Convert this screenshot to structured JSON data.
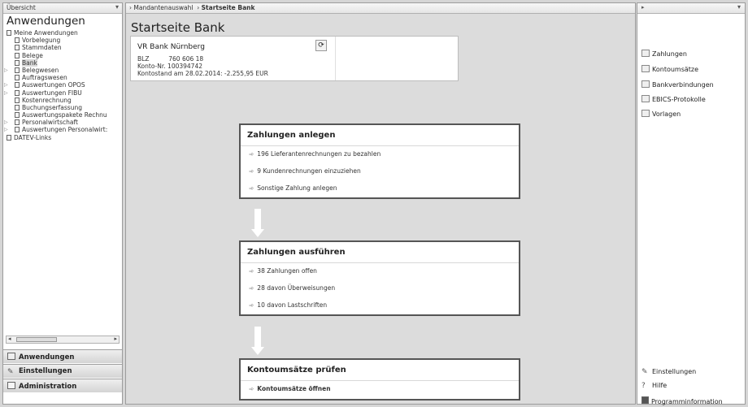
{
  "left_panel": {
    "header_label": "Übersicht",
    "title": "Anwendungen",
    "tree": [
      {
        "label": "Meine Anwendungen",
        "level": 0,
        "expander": "",
        "selected": false
      },
      {
        "label": "Vorbelegung",
        "level": 1,
        "expander": "",
        "selected": false
      },
      {
        "label": "Stammdaten",
        "level": 1,
        "expander": "",
        "selected": false
      },
      {
        "label": "Belege",
        "level": 1,
        "expander": "",
        "selected": false
      },
      {
        "label": "Bank",
        "level": 1,
        "expander": "",
        "selected": true
      },
      {
        "label": "Belegwesen",
        "level": 1,
        "expander": "▷",
        "selected": false
      },
      {
        "label": "Auftragswesen",
        "level": 1,
        "expander": "",
        "selected": false
      },
      {
        "label": "Auswertungen OPOS",
        "level": 1,
        "expander": "▷",
        "selected": false
      },
      {
        "label": "Auswertungen FIBU",
        "level": 1,
        "expander": "▷",
        "selected": false
      },
      {
        "label": "Kostenrechnung",
        "level": 1,
        "expander": "",
        "selected": false
      },
      {
        "label": "Buchungserfassung",
        "level": 1,
        "expander": "",
        "selected": false
      },
      {
        "label": "Auswertungspakete Rechnu",
        "level": 1,
        "expander": "",
        "selected": false
      },
      {
        "label": "Personalwirtschaft",
        "level": 1,
        "expander": "▷",
        "selected": false
      },
      {
        "label": "Auswertungen Personalwirt:",
        "level": 1,
        "expander": "▷",
        "selected": false
      },
      {
        "label": "DATEV-Links",
        "level": 0,
        "expander": "",
        "selected": false
      }
    ],
    "accordion": [
      {
        "label": "Anwendungen"
      },
      {
        "label": "Einstellungen"
      },
      {
        "label": "Administration"
      }
    ]
  },
  "breadcrumb": {
    "items": [
      "Mandantenauswahl",
      "Startseite Bank"
    ]
  },
  "main": {
    "title": "Startseite Bank",
    "bank": {
      "name": "VR Bank Nürnberg",
      "blz_label": "BLZ",
      "blz_value": "760 606 18",
      "konto_label": "Konto-Nr.",
      "konto_value": "100394742",
      "stand_label": "Kontostand am 28.02.2014:",
      "stand_value": "-2.255,95 EUR"
    },
    "sections": [
      {
        "title": "Zahlungen anlegen",
        "items": [
          "196 Lieferantenrechnungen zu bezahlen",
          "9 Kundenrechnungen einzuziehen",
          "Sonstige Zahlung anlegen"
        ]
      },
      {
        "title": "Zahlungen ausführen",
        "items": [
          "38 Zahlungen offen",
          "28 davon Überweisungen",
          "10 davon Lastschriften"
        ]
      },
      {
        "title": "Kontoumsätze prüfen",
        "items": [
          "Kontoumsätze öffnen"
        ]
      }
    ],
    "arrow_glyph": "➾"
  },
  "right_panel": {
    "links": [
      {
        "label": "Zahlungen",
        "icon": "payments-icon"
      },
      {
        "label": "Kontoumsätze",
        "icon": "account-transactions-icon"
      },
      {
        "label": "Bankverbindungen",
        "icon": "bank-connections-icon"
      },
      {
        "label": "EBICS-Protokolle",
        "icon": "ebics-protocol-icon"
      },
      {
        "label": "Vorlagen",
        "icon": "templates-icon"
      }
    ],
    "tools": [
      {
        "label": "Einstellungen",
        "icon": "wrench-icon"
      },
      {
        "label": "Hilfe",
        "icon": "help-icon"
      },
      {
        "label": "Programminformation",
        "icon": "info-icon"
      }
    ]
  }
}
